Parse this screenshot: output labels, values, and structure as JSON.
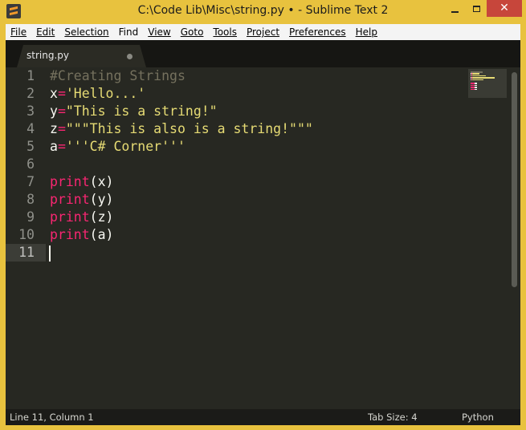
{
  "window": {
    "title": "C:\\Code Lib\\Misc\\string.py • - Sublime Text 2",
    "close_glyph": "✕"
  },
  "menu": [
    {
      "key": "F",
      "rest": "ile"
    },
    {
      "key": "E",
      "rest": "dit"
    },
    {
      "key": "S",
      "rest": "election"
    },
    {
      "key": "F",
      "rest": "ind",
      "key_pos": "first_plain"
    },
    {
      "key": "V",
      "rest": "iew"
    },
    {
      "key": "G",
      "rest": "oto"
    },
    {
      "key": "T",
      "rest": "ools"
    },
    {
      "key": "P",
      "rest": "roject"
    },
    {
      "key": "P",
      "rest": "references",
      "key_pos": "none"
    },
    {
      "key": "H",
      "rest": "elp"
    }
  ],
  "menu_labels": {
    "file": "File",
    "edit": "Edit",
    "selection": "Selection",
    "find": "Find",
    "view": "View",
    "goto": "Goto",
    "tools": "Tools",
    "project": "Project",
    "preferences": "Preferences",
    "help": "Help"
  },
  "tab": {
    "label": "string.py",
    "dirty": true
  },
  "editor": {
    "line_numbers": [
      "1",
      "2",
      "3",
      "4",
      "5",
      "6",
      "7",
      "8",
      "9",
      "10",
      "11"
    ],
    "active_line": 11,
    "lines": [
      {
        "tokens": [
          {
            "t": "#Creating Strings",
            "c": "comment"
          }
        ]
      },
      {
        "tokens": [
          {
            "t": "x",
            "c": "var"
          },
          {
            "t": "=",
            "c": "op"
          },
          {
            "t": "'Hello...'",
            "c": "str"
          }
        ]
      },
      {
        "tokens": [
          {
            "t": "y",
            "c": "var"
          },
          {
            "t": "=",
            "c": "op"
          },
          {
            "t": "\"This is a string!\"",
            "c": "str"
          }
        ]
      },
      {
        "tokens": [
          {
            "t": "z",
            "c": "var"
          },
          {
            "t": "=",
            "c": "op"
          },
          {
            "t": "\"\"\"This is also is a string!\"\"\"",
            "c": "str"
          }
        ]
      },
      {
        "tokens": [
          {
            "t": "a",
            "c": "var"
          },
          {
            "t": "=",
            "c": "op"
          },
          {
            "t": "'''C# Corner'''",
            "c": "str"
          }
        ]
      },
      {
        "tokens": []
      },
      {
        "tokens": [
          {
            "t": "print",
            "c": "kw"
          },
          {
            "t": "(x)",
            "c": "punc"
          }
        ]
      },
      {
        "tokens": [
          {
            "t": "print",
            "c": "kw"
          },
          {
            "t": "(y)",
            "c": "punc"
          }
        ]
      },
      {
        "tokens": [
          {
            "t": "print",
            "c": "kw"
          },
          {
            "t": "(z)",
            "c": "punc"
          }
        ]
      },
      {
        "tokens": [
          {
            "t": "print",
            "c": "kw"
          },
          {
            "t": "(a)",
            "c": "punc"
          }
        ]
      },
      {
        "tokens": []
      }
    ]
  },
  "status": {
    "position": "Line 11, Column 1",
    "tab_size": "Tab Size: 4",
    "syntax": "Python"
  },
  "colors": {
    "frame": "#e8c23e",
    "editor_bg": "#272822",
    "comment": "#75715e",
    "keyword": "#f92672",
    "string": "#e6db74",
    "text": "#f8f8f2",
    "close_button": "#c7463b"
  }
}
